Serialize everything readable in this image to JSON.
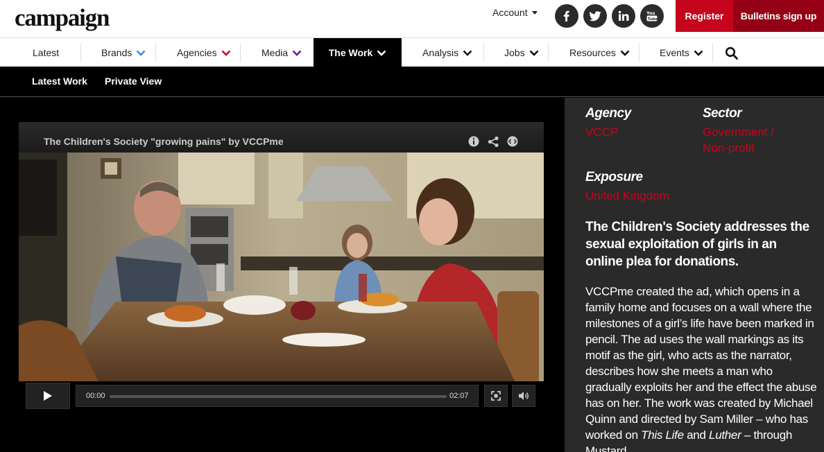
{
  "brand": {
    "logo_text": "campaign"
  },
  "header": {
    "account_label": "Account",
    "social": [
      "facebook-icon",
      "twitter-icon",
      "linkedin-icon",
      "youtube-icon"
    ],
    "register_label": "Register",
    "bulletins_label": "Bulletins sign up"
  },
  "nav": {
    "items": [
      {
        "label": "Latest"
      },
      {
        "label": "Brands",
        "chevron_color": "#3a8fd9"
      },
      {
        "label": "Agencies",
        "chevron_color": "#c4051c"
      },
      {
        "label": "Media",
        "chevron_color": "#6a1b9a"
      },
      {
        "label": "The Work",
        "active": true
      },
      {
        "label": "Analysis"
      },
      {
        "label": "Jobs"
      },
      {
        "label": "Resources"
      },
      {
        "label": "Events"
      }
    ]
  },
  "subnav": {
    "items": [
      {
        "label": "Latest Work"
      },
      {
        "label": "Private View"
      }
    ]
  },
  "video": {
    "title": "The Children's Society \"growing pains\" by VCCPme",
    "current_time": "00:00",
    "duration": "02:07",
    "progress": 0
  },
  "sidebar": {
    "agency_label": "Agency",
    "agency_value": "VCCP",
    "sector_label": "Sector",
    "sector_value_line1": "Government /",
    "sector_value_line2": "Non-profit",
    "exposure_label": "Exposure",
    "exposure_value": "United Kingdom",
    "headline": "The Children's Society addresses the sexual exploitation of girls in an online plea for donations.",
    "body_pre": "VCCPme created the ad, which opens in a family home and focuses on a wall where the milestones of a girl’s life have been marked in pencil. The ad uses the wall markings as its motif as the girl, who acts as the narrator, describes how she meets a man who gradually exploits her and the effect the abuse has on her. The work was created by Michael Quinn and directed by Sam Miller – who has worked on ",
    "body_em1": "This Life",
    "body_mid": " and ",
    "body_em2": "Luther",
    "body_post": " – through Mustard."
  },
  "colors": {
    "accent_red": "#c4051c",
    "bulletins_red": "#950016",
    "sidebar_bg": "#2a2a2a"
  }
}
